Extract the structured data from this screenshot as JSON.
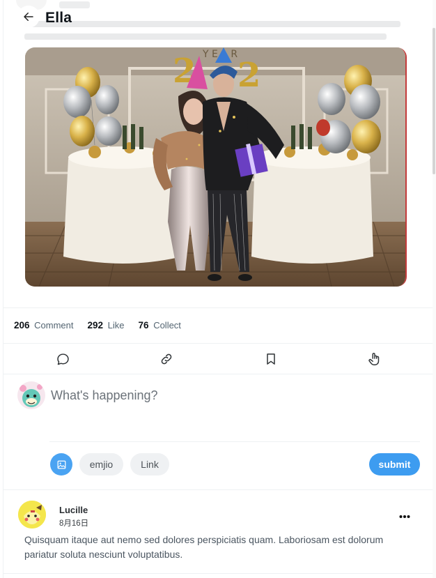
{
  "header": {
    "title": "Ella"
  },
  "post": {
    "image_alt": "New Year party photo of a couple in party hats beside balloons and tables"
  },
  "stats": [
    {
      "count": "206",
      "label": "Comment"
    },
    {
      "count": "292",
      "label": "Like"
    },
    {
      "count": "76",
      "label": "Collect"
    }
  ],
  "actions": [
    "comment-icon",
    "link-icon",
    "bookmark-icon",
    "tap-icon"
  ],
  "composer": {
    "placeholder": "What's happening?",
    "emoji_label": "emjio",
    "link_label": "Link",
    "submit_label": "submit"
  },
  "comment": {
    "author": "Lucille",
    "date": "8月16日",
    "text": "Quisquam itaque aut nemo sed dolores perspiciatis quam. Laboriosam est dolorum pariatur soluta nesciunt voluptatibus."
  },
  "colors": {
    "accent": "#3d9cf0",
    "media_button": "#4aa3f2",
    "muted_text": "#536471"
  }
}
